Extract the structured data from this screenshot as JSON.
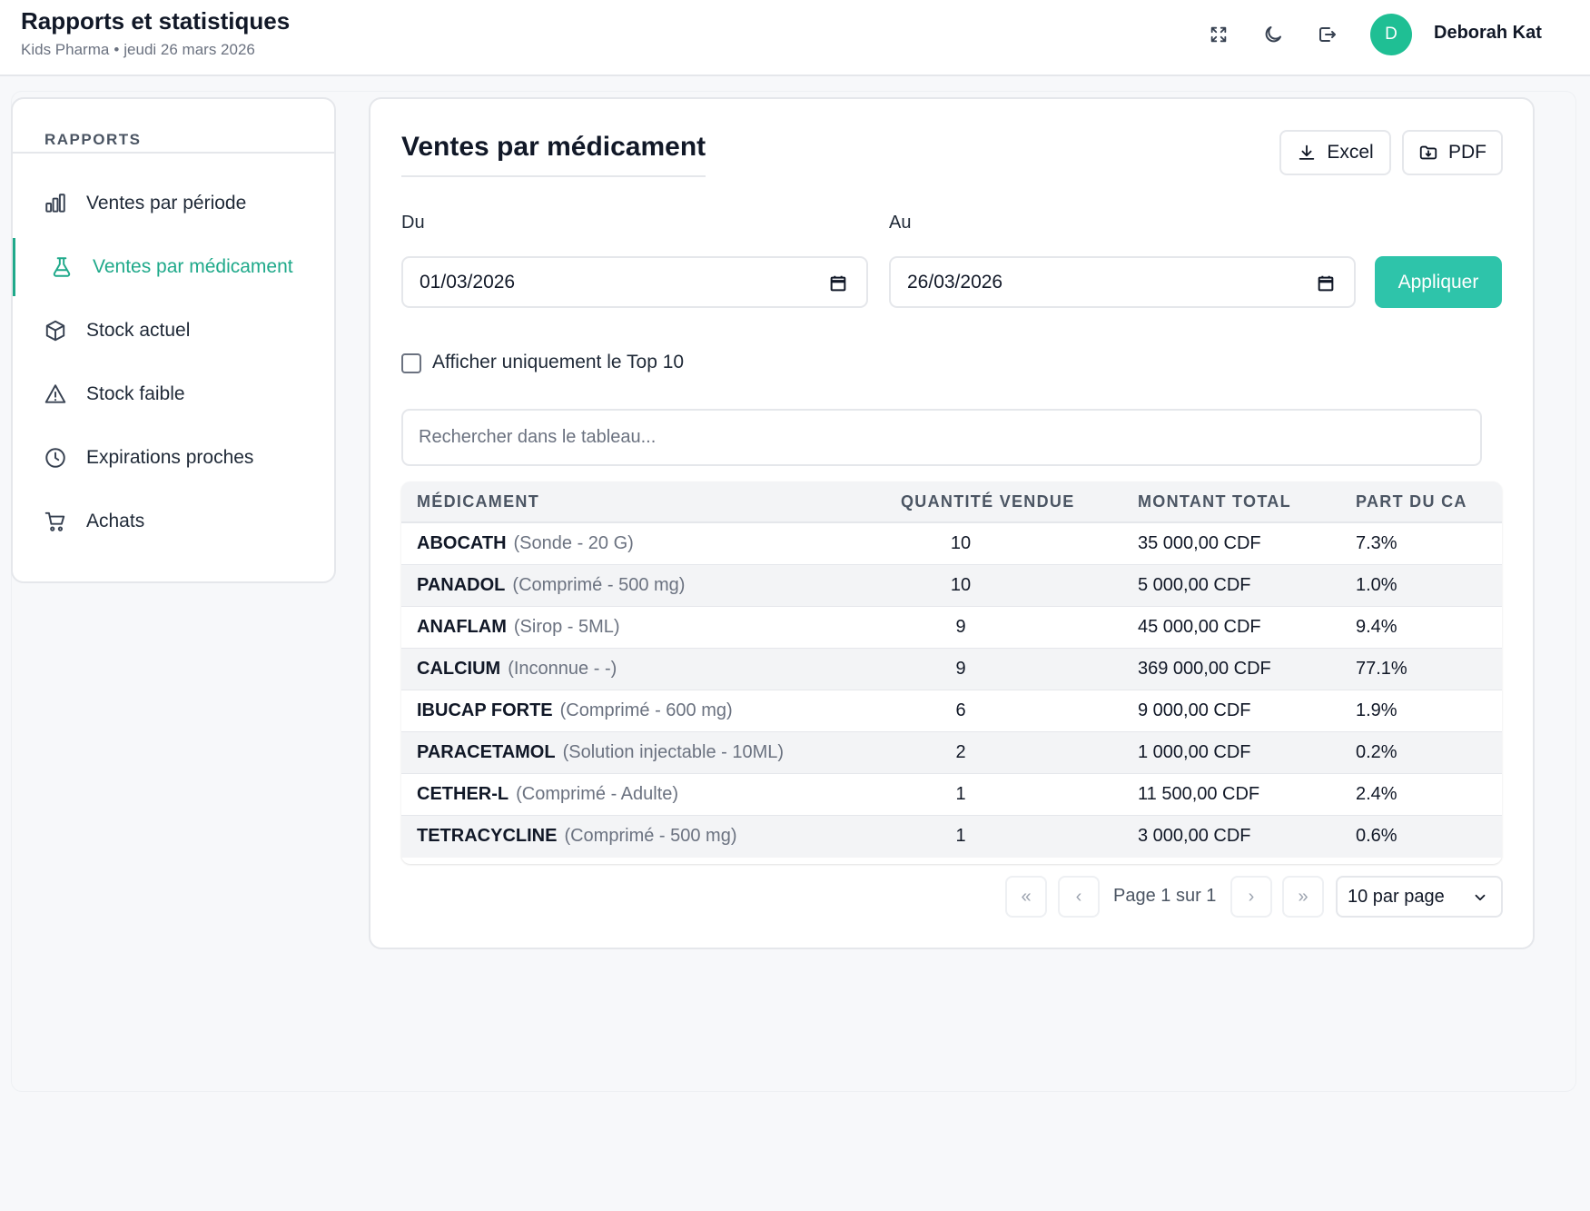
{
  "header": {
    "title": "Rapports et statistiques",
    "company": "Kids Pharma",
    "separator": "•",
    "date": "jeudi 26 mars 2026",
    "user_initial": "D",
    "user_name": "Deborah Kat",
    "icons": [
      "fullscreen-icon",
      "moon-icon",
      "logout-icon"
    ]
  },
  "sidebar": {
    "heading": "RAPPORTS",
    "items": [
      {
        "label": "Ventes par période",
        "icon": "bar-chart-icon"
      },
      {
        "label": "Ventes par médicament",
        "icon": "flask-icon",
        "active": true
      },
      {
        "label": "Stock actuel",
        "icon": "box-icon"
      },
      {
        "label": "Stock faible",
        "icon": "warning-icon"
      },
      {
        "label": "Expirations proches",
        "icon": "clock-icon"
      },
      {
        "label": "Achats",
        "icon": "cart-icon"
      }
    ]
  },
  "main": {
    "title": "Ventes par médicament",
    "excel_label": "Excel",
    "pdf_label": "PDF",
    "from_label": "Du",
    "to_label": "Au",
    "from_value": "01/03/2026",
    "to_value": "26/03/2026",
    "apply_label": "Appliquer",
    "top10_label": "Afficher uniquement le Top 10",
    "search_placeholder": "Rechercher dans le tableau...",
    "table": {
      "headers": [
        "MÉDICAMENT",
        "QUANTITÉ VENDUE",
        "MONTANT TOTAL",
        "PART DU CA"
      ],
      "rows": [
        {
          "name": "ABOCATH",
          "form": "(Sonde - 20 G)",
          "qty": "10",
          "amount": "35 000,00 CDF",
          "share": "7.3%"
        },
        {
          "name": "PANADOL",
          "form": "(Comprimé - 500 mg)",
          "qty": "10",
          "amount": "5 000,00 CDF",
          "share": "1.0%"
        },
        {
          "name": "ANAFLAM",
          "form": "(Sirop - 5ML)",
          "qty": "9",
          "amount": "45 000,00 CDF",
          "share": "9.4%"
        },
        {
          "name": "CALCIUM",
          "form": "(Inconnue - -)",
          "qty": "9",
          "amount": "369 000,00 CDF",
          "share": "77.1%"
        },
        {
          "name": "IBUCAP FORTE",
          "form": "(Comprimé - 600 mg)",
          "qty": "6",
          "amount": "9 000,00 CDF",
          "share": "1.9%"
        },
        {
          "name": "PARACETAMOL",
          "form": "(Solution injectable - 10ML)",
          "qty": "2",
          "amount": "1 000,00 CDF",
          "share": "0.2%"
        },
        {
          "name": "CETHER-L",
          "form": "(Comprimé - Adulte)",
          "qty": "1",
          "amount": "11 500,00 CDF",
          "share": "2.4%"
        },
        {
          "name": "TETRACYCLINE",
          "form": "(Comprimé - 500 mg)",
          "qty": "1",
          "amount": "3 000,00 CDF",
          "share": "0.6%"
        }
      ]
    },
    "pagination": {
      "first": "«",
      "prev": "‹",
      "page_label": "Page 1 sur 1",
      "next": "›",
      "last": "»",
      "per_page": "10 par page"
    }
  }
}
